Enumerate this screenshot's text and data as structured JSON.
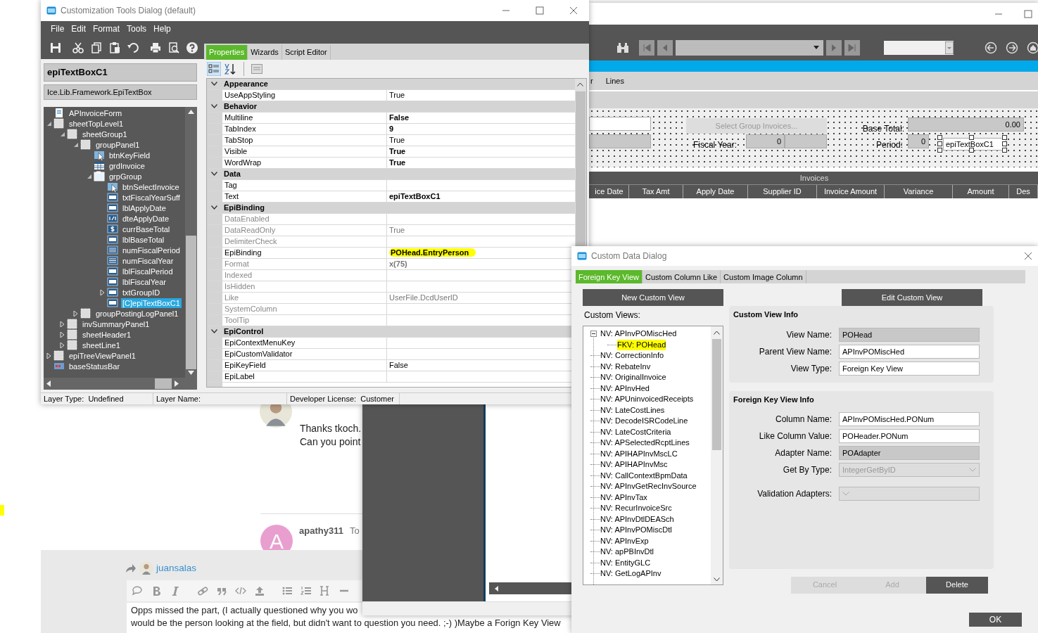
{
  "forum": {
    "post_lines": [
      "Thanks tkoch.",
      "Can you point"
    ],
    "reply_author": "apathy311",
    "reply_snippet": "To",
    "avatar_letter": "A",
    "reply_to": "juansalas",
    "editor_lines": [
      "Opps missed the part, (I actually questioned why you wo",
      "would be the person looking at the field, but didn't want to question you need. ;-) )Maybe a Forign Key View"
    ]
  },
  "app": {
    "tabs": [
      {
        "label": "r",
        "selected": false
      },
      {
        "label": "Lines",
        "selected": false
      }
    ],
    "select_button": "Select Group Invoices...",
    "base_total_label": "Base Total:",
    "base_total": "0.00",
    "fiscal_year_label": "Fiscal Year:",
    "fiscal_year": "0",
    "period_label": "Period:",
    "period": "0",
    "new_textbox": "epiTextBoxC1",
    "grid_title": "Invoices",
    "columns": [
      "ice Date",
      "Tax Amt",
      "Apply Date",
      "Supplier ID",
      "Invoice Amount",
      "Variance",
      "Amount",
      "Des"
    ]
  },
  "customization": {
    "title": "Customization Tools Dialog (default)",
    "menu": [
      "File",
      "Edit",
      "Format",
      "Tools",
      "Help"
    ],
    "control_name": "epiTextBoxC1",
    "control_type": "Ice.Lib.Framework.EpiTextBox",
    "tree": [
      {
        "label": "APInvoiceForm",
        "kind": "form",
        "selected": false
      },
      {
        "label": "sheetTopLevel1",
        "kind": "sheet",
        "selected": false,
        "expanded": true,
        "children": [
          {
            "label": "sheetGroup1",
            "kind": "sheet",
            "selected": false,
            "expanded": true,
            "children": [
              {
                "label": "groupPanel1",
                "kind": "sheet",
                "selected": false,
                "expanded": true,
                "children": [
                  {
                    "label": "btnKeyField",
                    "kind": "button",
                    "selected": false
                  },
                  {
                    "label": "grdInvoice",
                    "kind": "grid",
                    "selected": false
                  },
                  {
                    "label": "grpGroup",
                    "kind": "group",
                    "selected": false,
                    "expanded": true,
                    "children": [
                      {
                        "label": "btnSelectInvoice",
                        "kind": "button",
                        "selected": false
                      },
                      {
                        "label": "txtFiscalYearSuff",
                        "kind": "text",
                        "selected": false
                      },
                      {
                        "label": "lblApplyDate",
                        "kind": "text",
                        "selected": false
                      },
                      {
                        "label": "dteApplyDate",
                        "kind": "date",
                        "selected": false
                      },
                      {
                        "label": "currBaseTotal",
                        "kind": "currency",
                        "selected": false
                      },
                      {
                        "label": "lblBaseTotal",
                        "kind": "text",
                        "selected": false
                      },
                      {
                        "label": "numFiscalPeriod",
                        "kind": "number",
                        "selected": false
                      },
                      {
                        "label": "numFiscalYear",
                        "kind": "number",
                        "selected": false
                      },
                      {
                        "label": "lblFiscalPeriod",
                        "kind": "text",
                        "selected": false
                      },
                      {
                        "label": "lblFiscalYear",
                        "kind": "text",
                        "selected": false
                      },
                      {
                        "label": "txtGroupID",
                        "kind": "text",
                        "selected": false,
                        "expanded": false
                      },
                      {
                        "label": "[C]epiTextBoxC1",
                        "kind": "text",
                        "selected": true
                      }
                    ]
                  }
                ]
              },
              {
                "label": "groupPostingLogPanel1",
                "kind": "sheet",
                "selected": false,
                "expanded": false
              }
            ]
          },
          {
            "label": "invSummaryPanel1",
            "kind": "sheet",
            "selected": false,
            "expanded": false
          },
          {
            "label": "sheetHeader1",
            "kind": "sheet",
            "selected": false,
            "expanded": false
          },
          {
            "label": "sheetLine1",
            "kind": "sheet",
            "selected": false,
            "expanded": false
          }
        ]
      },
      {
        "label": "epiTreeViewPanel1",
        "kind": "sheet",
        "selected": false,
        "expanded": false
      },
      {
        "label": "baseStatusBar",
        "kind": "status",
        "selected": false
      }
    ],
    "tabs": [
      {
        "label": "Properties",
        "selected": true
      },
      {
        "label": "Wizards",
        "selected": false
      },
      {
        "label": "Script Editor",
        "selected": false
      }
    ],
    "categories": [
      {
        "name": "Appearance",
        "expanded": true,
        "rows": [
          {
            "name": "UseAppStyling",
            "value": "True",
            "bold": false,
            "dim": false
          }
        ]
      },
      {
        "name": "Behavior",
        "expanded": true,
        "rows": [
          {
            "name": "Multiline",
            "value": "False",
            "bold": true,
            "dim": false
          },
          {
            "name": "TabIndex",
            "value": "9",
            "bold": true,
            "dim": false
          },
          {
            "name": "TabStop",
            "value": "True",
            "bold": false,
            "dim": false
          },
          {
            "name": "Visible",
            "value": "True",
            "bold": true,
            "dim": false
          },
          {
            "name": "WordWrap",
            "value": "True",
            "bold": true,
            "dim": false
          }
        ]
      },
      {
        "name": "Data",
        "expanded": true,
        "rows": [
          {
            "name": "Tag",
            "dim": false
          },
          {
            "name": "Text",
            "value": "epiTextBoxC1",
            "bold": true,
            "dim": false
          }
        ]
      },
      {
        "name": "EpiBinding",
        "expanded": true,
        "rows": [
          {
            "name": "DataEnabled",
            "dim": true
          },
          {
            "name": "DataReadOnly",
            "value": "True",
            "bold": false,
            "dim": true
          },
          {
            "name": "DelimiterCheck",
            "dim": true
          },
          {
            "name": "EpiBinding",
            "value": "POHead.EntryPerson",
            "bold": true,
            "dim": false,
            "highlighted": true
          },
          {
            "name": "Format",
            "value": "x(75)",
            "bold": true,
            "dim": true
          },
          {
            "name": "Indexed",
            "dim": true
          },
          {
            "name": "IsHidden",
            "dim": true
          },
          {
            "name": "Like",
            "value": "UserFile.DcdUserID",
            "bold": false,
            "dim": true
          },
          {
            "name": "SystemColumn",
            "dim": true
          },
          {
            "name": "ToolTip",
            "dim": true
          }
        ]
      },
      {
        "name": "EpiControl",
        "expanded": true,
        "rows": [
          {
            "name": "EpiContextMenuKey",
            "dim": false
          },
          {
            "name": "EpiCustomValidator",
            "dim": false
          },
          {
            "name": "EpiKeyField",
            "value": "False",
            "bold": false,
            "dim": false
          },
          {
            "name": "EpiLabel",
            "dim": false
          }
        ]
      }
    ],
    "status": [
      {
        "label": "Layer Type:",
        "value": "Undefined"
      },
      {
        "label": "Layer Name:"
      },
      {
        "label": "Developer License:",
        "value": "Customer"
      }
    ]
  },
  "custom_data": {
    "title": "Custom Data Dialog",
    "tabs": [
      {
        "label": "Foreign Key View",
        "selected": true
      },
      {
        "label": "Custom Column Like",
        "selected": false
      },
      {
        "label": "Custom Image Column",
        "selected": false
      }
    ],
    "new_button": "New Custom View",
    "edit_button": "Edit Custom View",
    "views_label": "Custom Views:",
    "views": [
      {
        "label": "NV: APInvPOMiscHed",
        "selected": false,
        "expanded": true,
        "children": [
          {
            "label": "FKV: POHead",
            "selected": false,
            "highlighted": true
          }
        ]
      },
      {
        "label": "NV: CorrectionInfo",
        "selected": false
      },
      {
        "label": "NV: RebateInv",
        "selected": false
      },
      {
        "label": "NV: OriginalInvoice",
        "selected": false
      },
      {
        "label": "NV: APInvHed",
        "selected": false
      },
      {
        "label": "NV: APUninvoicedReceipts",
        "selected": false
      },
      {
        "label": "NV: LateCostLines",
        "selected": false
      },
      {
        "label": "NV: DecodeISRCodeLine",
        "selected": false
      },
      {
        "label": "NV: LateCostCriteria",
        "selected": false
      },
      {
        "label": "NV: APSelectedRcptLines",
        "selected": false
      },
      {
        "label": "NV: APIHAPInvMscLC",
        "selected": false
      },
      {
        "label": "NV: APIHAPInvMsc",
        "selected": false
      },
      {
        "label": "NV: CallContextBpmData",
        "selected": false
      },
      {
        "label": "NV: APInvGetRecInvSource",
        "selected": false
      },
      {
        "label": "NV: APInvTax",
        "selected": false
      },
      {
        "label": "NV: RecurInvoiceSrc",
        "selected": false
      },
      {
        "label": "NV: APInvDtlDEASch",
        "selected": false
      },
      {
        "label": "NV: APInvPOMiscDtl",
        "selected": false
      },
      {
        "label": "NV: APInvExp",
        "selected": false
      },
      {
        "label": "NV: apPBInvDtl",
        "selected": false
      },
      {
        "label": "NV: EntityGLC",
        "selected": false
      },
      {
        "label": "NV: GetLogAPInv",
        "selected": false
      }
    ],
    "groups": [
      {
        "title": "Custom View Info",
        "fields": [
          {
            "label": "View Name:",
            "value": "POHead",
            "kind": "readonly"
          },
          {
            "label": "Parent View Name:",
            "value": "APInvPOMiscHed",
            "kind": "text"
          },
          {
            "label": "View Type:",
            "value": "Foreign Key View",
            "kind": "text"
          }
        ]
      },
      {
        "title": "Foreign Key View Info",
        "fields": [
          {
            "label": "Column Name:",
            "value": "APInvPOMiscHed.PONum",
            "kind": "text"
          },
          {
            "label": "Like Column Value:",
            "value": "POHeader.PONum",
            "kind": "text"
          },
          {
            "label": "Adapter Name:",
            "value": "POAdapter",
            "kind": "readonly"
          },
          {
            "label": "Get By Type:",
            "value": "IntegerGetByID",
            "kind": "select"
          },
          {
            "label": "Validation Adapters:",
            "kind": "select"
          }
        ]
      }
    ],
    "actions": [
      {
        "label": "Cancel",
        "disabled": true
      },
      {
        "label": "Add",
        "disabled": true
      },
      {
        "label": "Delete",
        "disabled": false
      }
    ],
    "ok_button": "OK"
  }
}
